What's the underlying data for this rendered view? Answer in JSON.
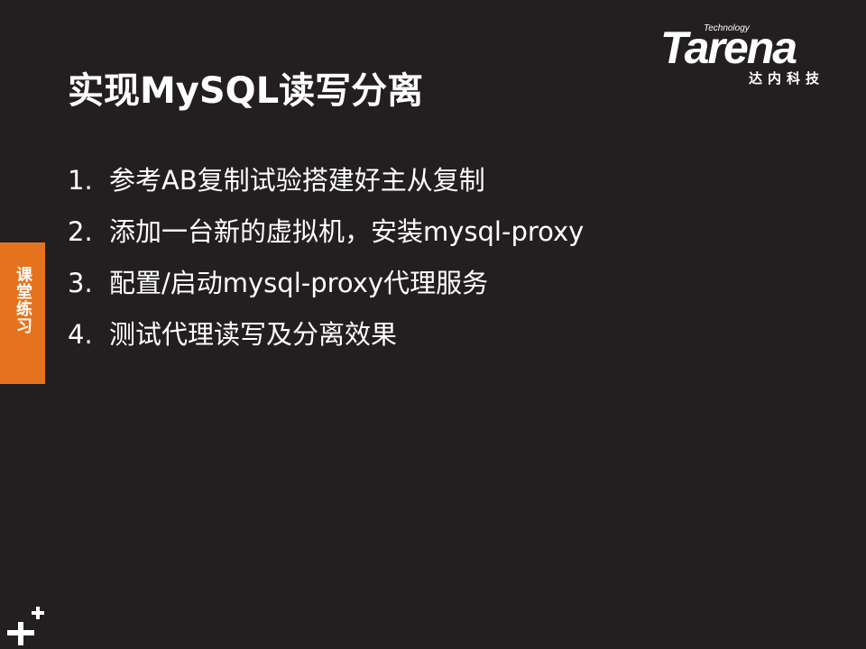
{
  "slide": {
    "title": "实现MySQL读写分离",
    "logo": {
      "technology": "Technology",
      "wordmark": "Tarena",
      "chinese": "达内科技"
    },
    "side_tab": "课堂练习",
    "steps": [
      {
        "num": "1.",
        "text": "参考AB复制试验搭建好主从复制"
      },
      {
        "num": "2.",
        "text": "添加一台新的虚拟机，安装mysql-proxy"
      },
      {
        "num": "3.",
        "text": "配置/启动mysql-proxy代理服务"
      },
      {
        "num": "4.",
        "text": "测试代理读写及分离效果"
      }
    ],
    "colors": {
      "background": "#231f20",
      "accent": "#e5731d",
      "text": "#ffffff"
    },
    "icons": {
      "corner": "plus-plus-icon"
    }
  }
}
